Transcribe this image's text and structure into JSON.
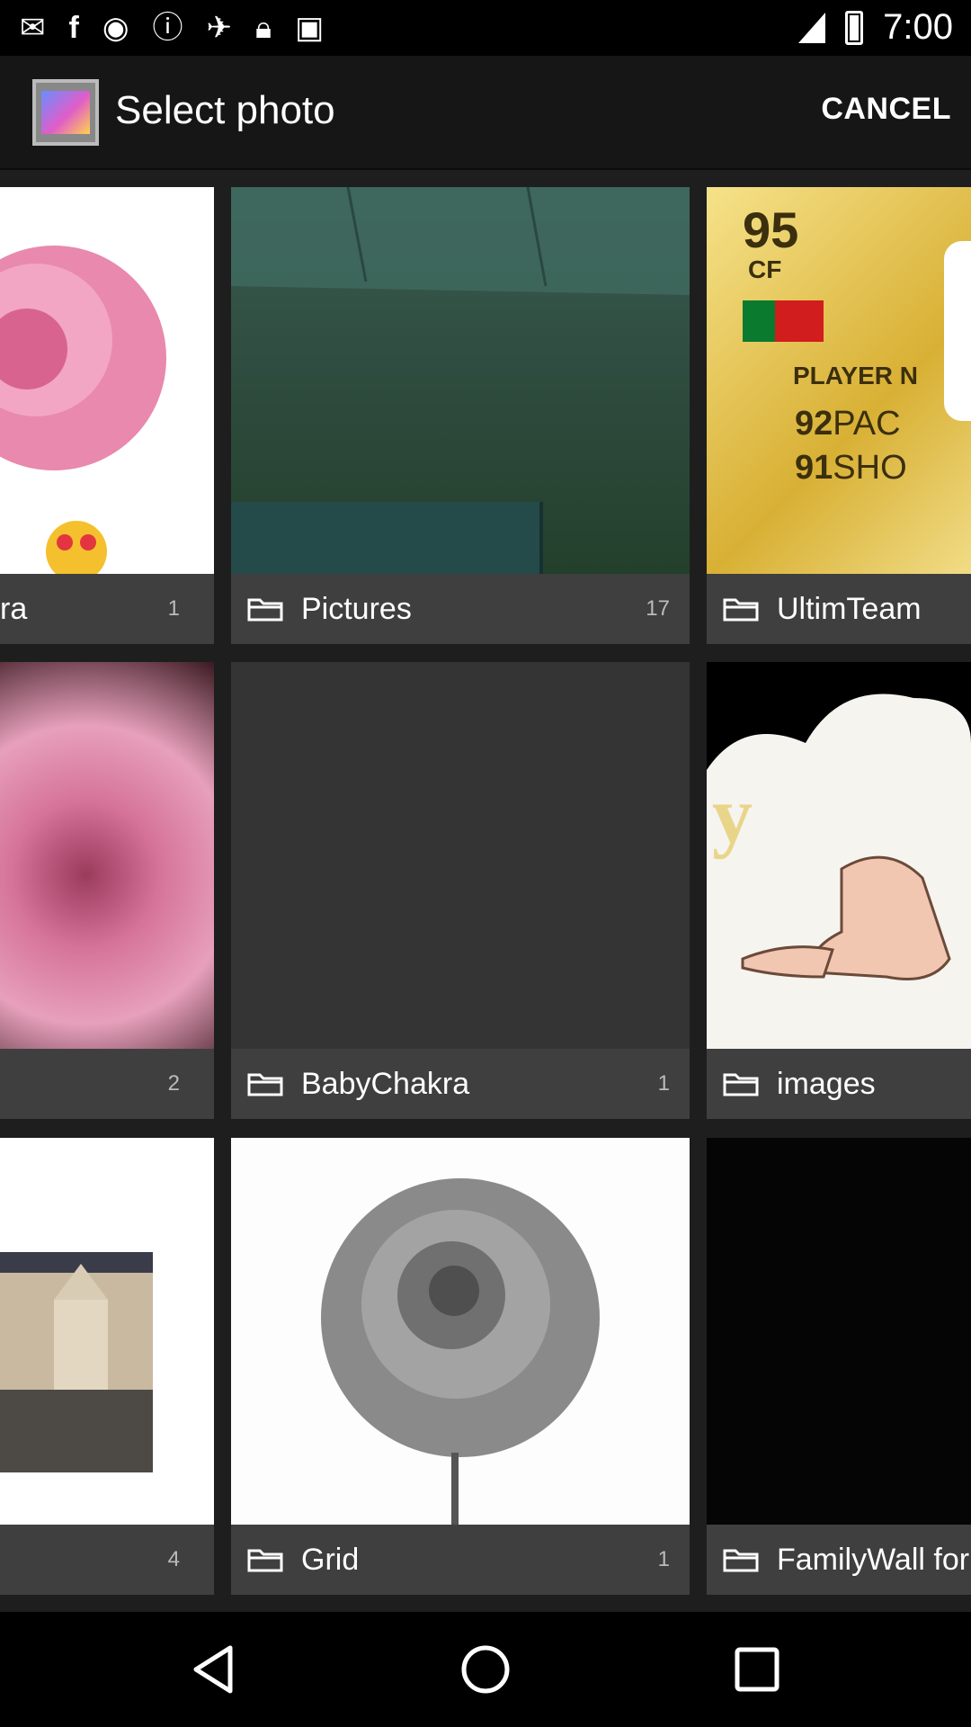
{
  "status_bar": {
    "time": "7:00",
    "icons": [
      "mail-icon",
      "facebook-icon",
      "eye-icon",
      "info-icon",
      "fake-gps-icon",
      "lock-icon",
      "android-icon"
    ]
  },
  "action_bar": {
    "title": "Select photo",
    "cancel_label": "CANCEL"
  },
  "folders": [
    {
      "name": "ra",
      "count": "1"
    },
    {
      "name": "Pictures",
      "count": "17"
    },
    {
      "name": "UltimTeam",
      "count": ""
    },
    {
      "name": "",
      "count": "2"
    },
    {
      "name": "BabyChakra",
      "count": "1"
    },
    {
      "name": "images",
      "count": ""
    },
    {
      "name": "",
      "count": "4"
    },
    {
      "name": "Grid",
      "count": "1"
    },
    {
      "name": "FamilyWall for",
      "count": ""
    }
  ],
  "thumbnail_text": {
    "card_rating": "95",
    "card_position": "CF",
    "card_player": "PLAYER N",
    "card_stat1_value": "92",
    "card_stat1_label": "PAC",
    "card_stat2_value": "91",
    "card_stat2_label": "SHO"
  },
  "colors": {
    "background": "#1e1e1e",
    "caption": "#3f3f3f",
    "action_bar": "#161616"
  }
}
